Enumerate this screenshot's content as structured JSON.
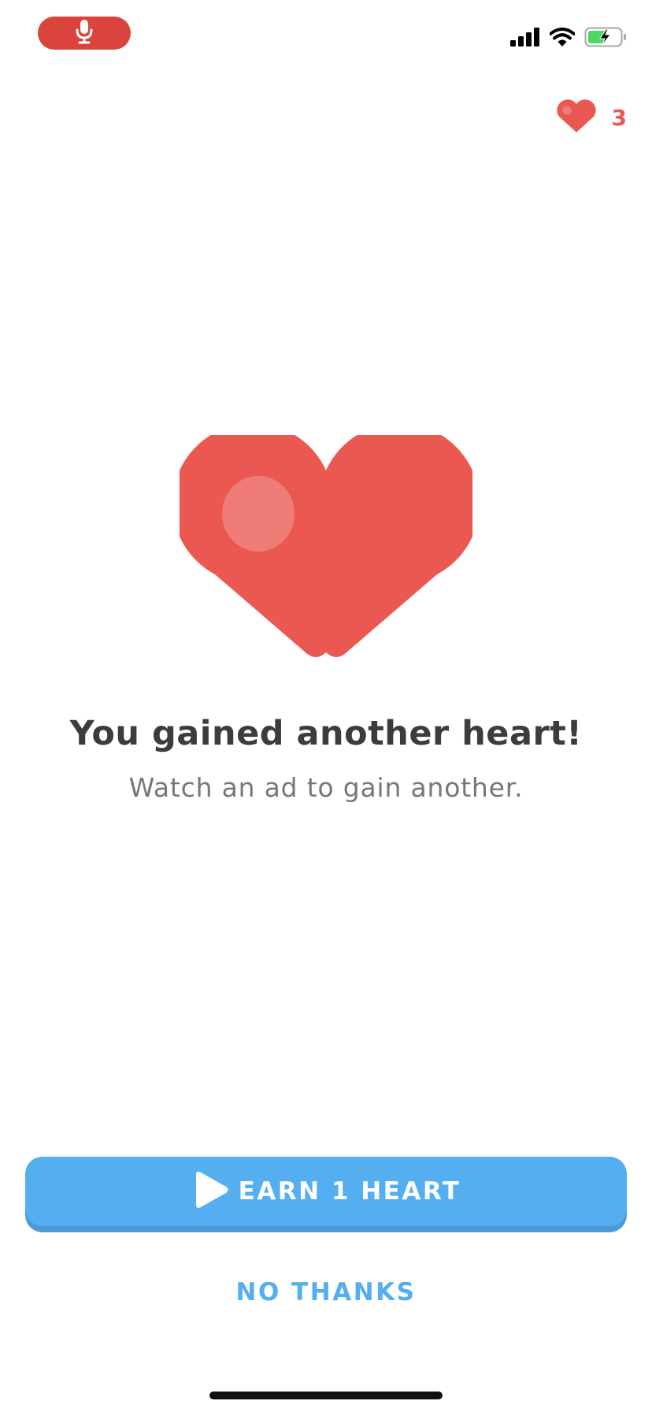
{
  "status_bar": {
    "mic_icon": "microphone-icon",
    "signal_icon": "cellular-signal-icon",
    "wifi_icon": "wifi-icon",
    "battery_icon": "battery-charging-icon"
  },
  "hearts": {
    "count": "3",
    "icon": "heart-icon",
    "color": "#ea5851"
  },
  "main": {
    "title": "You gained another heart!",
    "subtitle": "Watch an ad to gain another."
  },
  "actions": {
    "earn_label": "EARN 1 HEART",
    "earn_icon": "play-icon",
    "no_thanks_label": "NO THANKS",
    "accent_color": "#54aef0"
  }
}
